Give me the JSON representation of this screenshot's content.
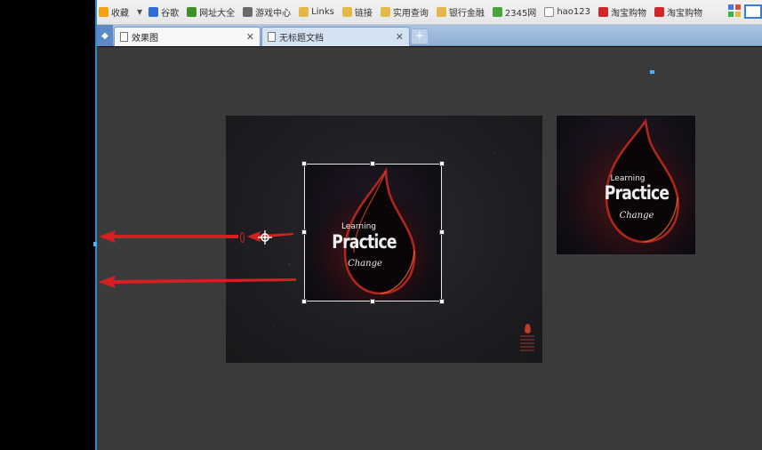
{
  "bookmarks": {
    "items": [
      {
        "label": "收藏",
        "icon": "star-icon"
      },
      {
        "label": "谷歌",
        "icon": "google-icon"
      },
      {
        "label": "网址大全",
        "icon": "site-directory-icon"
      },
      {
        "label": "游戏中心",
        "icon": "gamepad-icon"
      },
      {
        "label": "Links",
        "icon": "folder-icon"
      },
      {
        "label": "链接",
        "icon": "folder-icon"
      },
      {
        "label": "实用查询",
        "icon": "folder-icon"
      },
      {
        "label": "银行金融",
        "icon": "folder-icon"
      },
      {
        "label": "2345网",
        "icon": "globe-icon"
      },
      {
        "label": "hao123",
        "icon": "page-icon"
      },
      {
        "label": "淘宝购物",
        "icon": "taobao-icon"
      },
      {
        "label": "淘宝购物",
        "icon": "taobao-icon"
      }
    ]
  },
  "tabs": [
    {
      "label": "效果图",
      "active": true
    },
    {
      "label": "无标题文档",
      "active": false
    }
  ],
  "artwork": {
    "line1": "Learning",
    "line2": "Practice",
    "line3": "Change"
  },
  "colors": {
    "workspace": "#3b3b3b",
    "ruler": "#1e8fd6",
    "arrow": "#d42020",
    "tab_bar": "#8eaed6"
  }
}
